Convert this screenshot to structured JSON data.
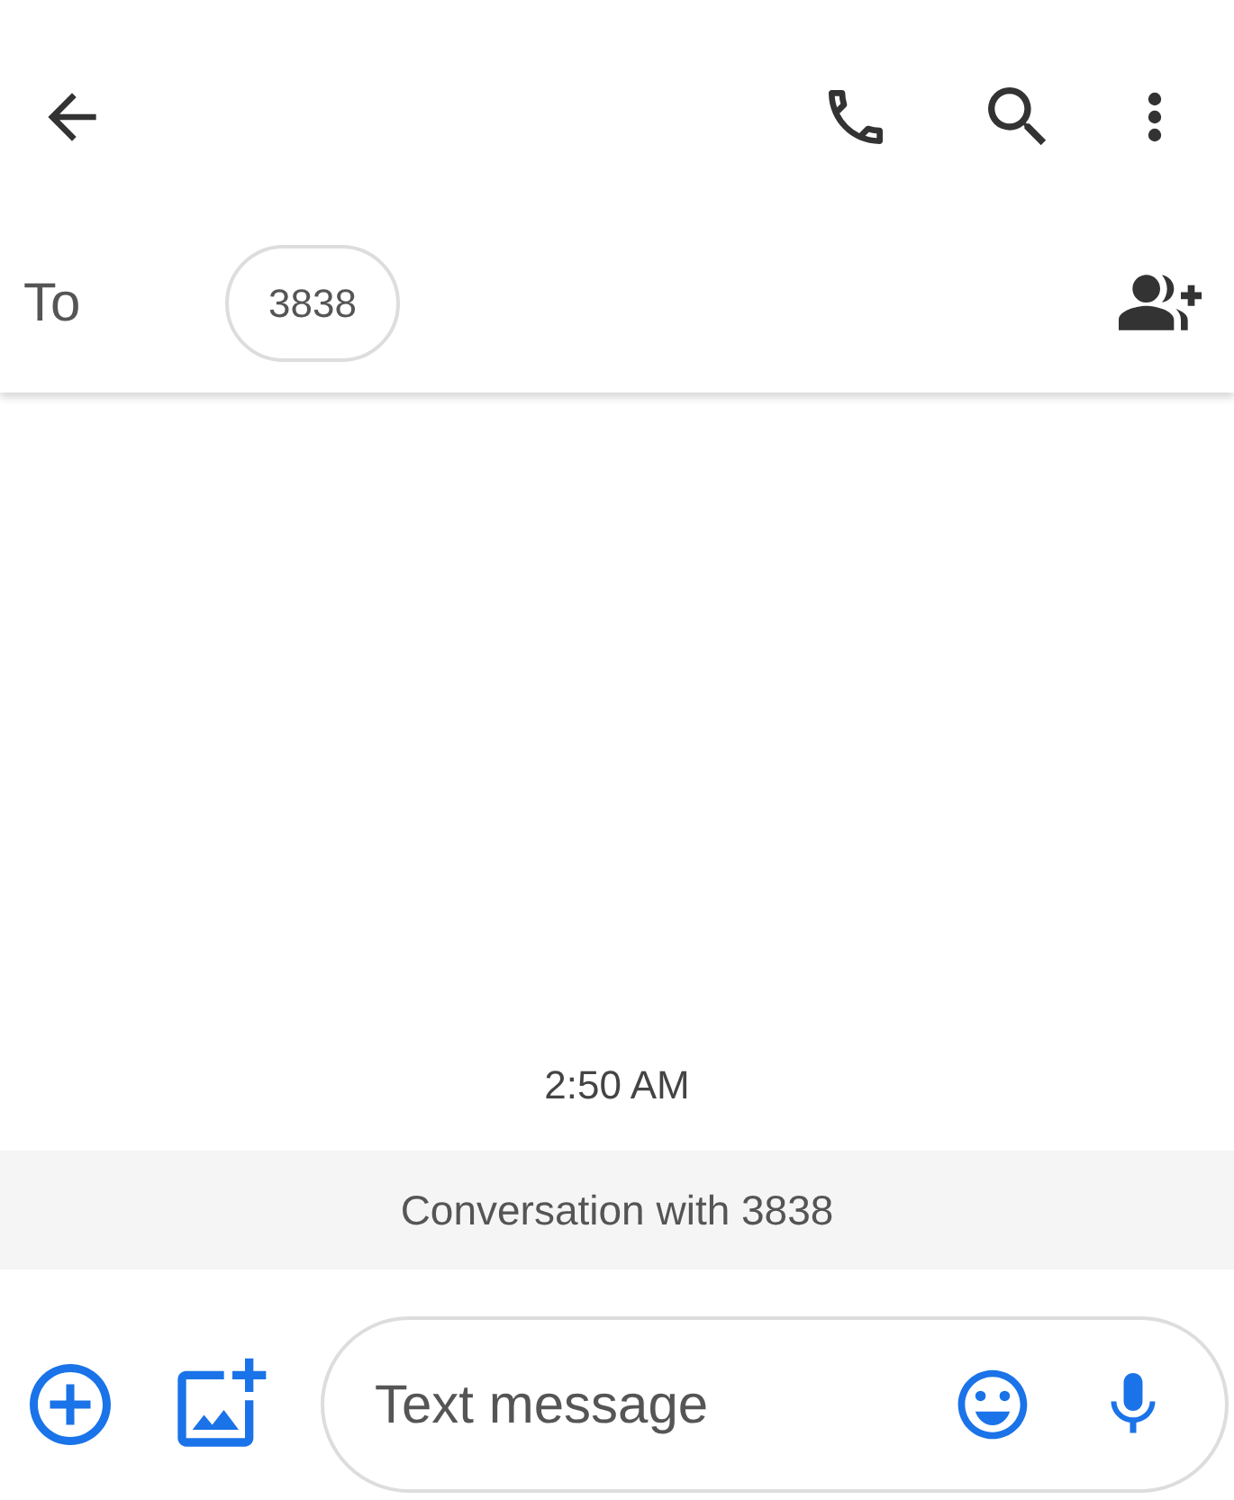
{
  "recipients": {
    "label": "To",
    "chips": [
      "3838"
    ]
  },
  "timestamp": "2:50 AM",
  "banner": "Conversation with 3838",
  "compose": {
    "placeholder": "Text message"
  }
}
